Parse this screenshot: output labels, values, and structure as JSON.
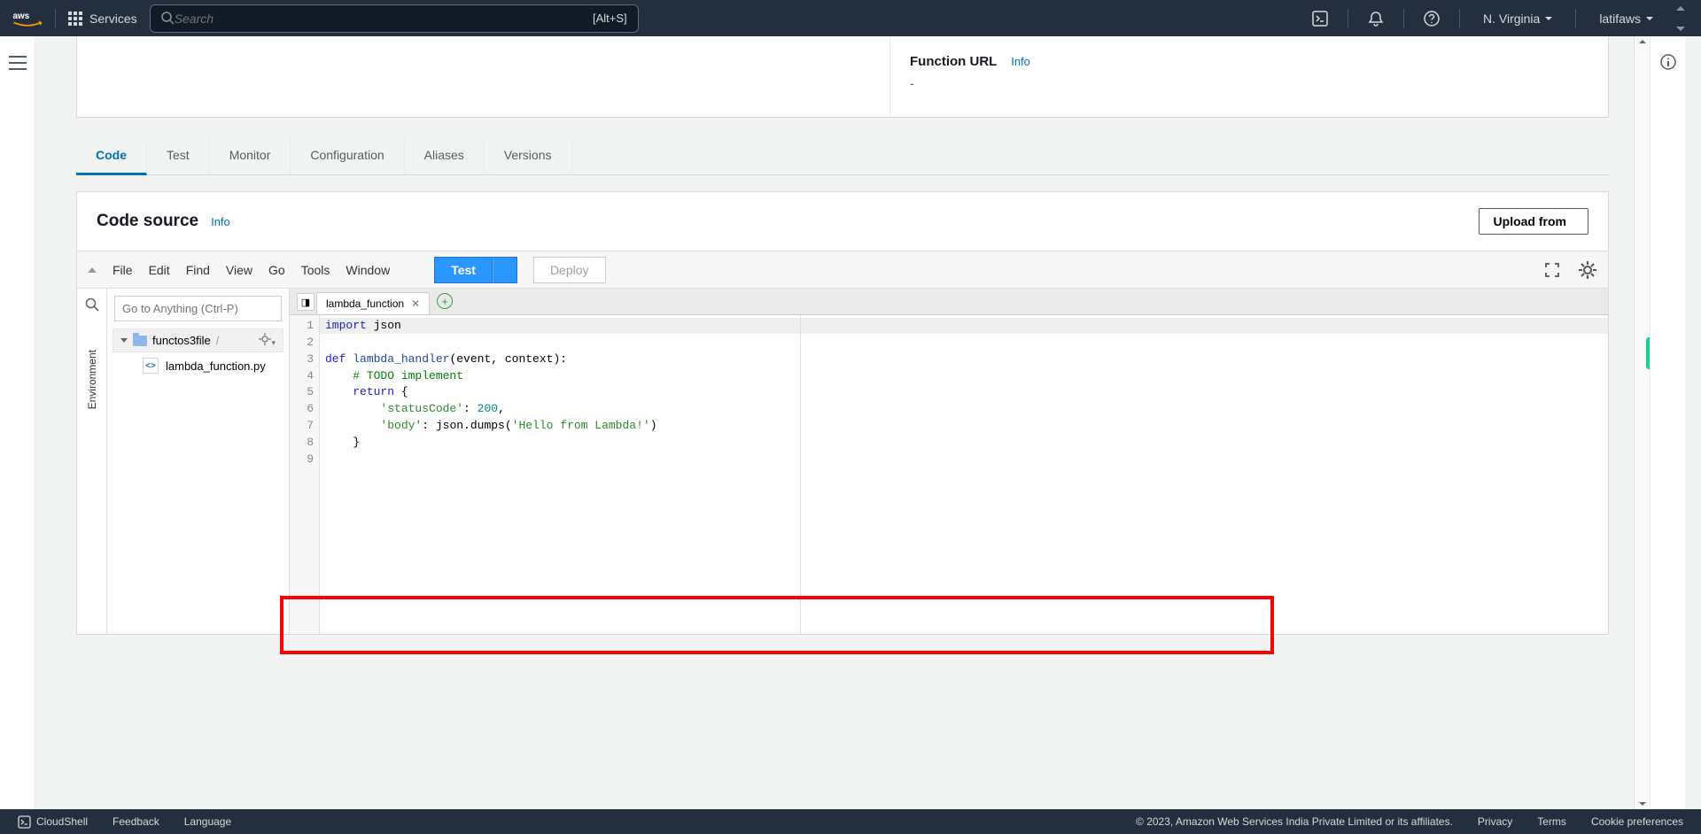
{
  "topbar": {
    "services": "Services",
    "search_placeholder": "Search",
    "search_hotkey": "[Alt+S]",
    "region": "N. Virginia",
    "user": "latifaws"
  },
  "panel": {
    "function_url_label": "Function URL",
    "info": "Info",
    "function_url_value": "-"
  },
  "tabs": [
    "Code",
    "Test",
    "Monitor",
    "Configuration",
    "Aliases",
    "Versions"
  ],
  "card": {
    "title": "Code source",
    "info": "Info",
    "upload": "Upload from"
  },
  "ide": {
    "menu": [
      "File",
      "Edit",
      "Find",
      "View",
      "Go",
      "Tools",
      "Window"
    ],
    "test": "Test",
    "deploy": "Deploy",
    "goto_placeholder": "Go to Anything (Ctrl-P)",
    "env_label": "Environment",
    "folder": "functos3file",
    "file": "lambda_function.py",
    "tab": "lambda_function",
    "code_lines": 9
  },
  "footer": {
    "cloudshell": "CloudShell",
    "feedback": "Feedback",
    "language": "Language",
    "copyright": "© 2023, Amazon Web Services India Private Limited or its affiliates.",
    "privacy": "Privacy",
    "terms": "Terms",
    "cookies": "Cookie preferences"
  }
}
